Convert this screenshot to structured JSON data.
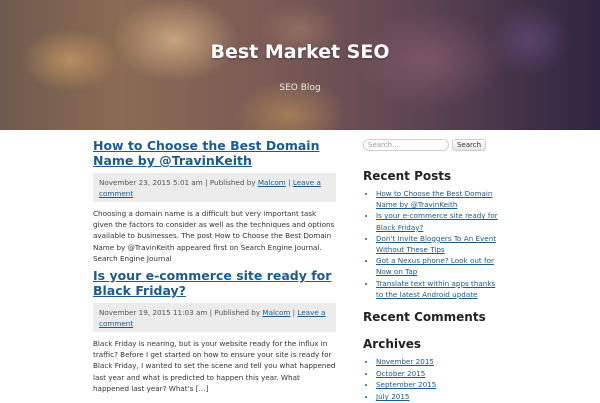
{
  "site": {
    "title": "Best Market SEO",
    "tagline": "SEO Blog"
  },
  "posts": [
    {
      "title": "How to Choose the Best Domain Name by @TravinKeith",
      "date": "November 23, 2015 5:01 am",
      "published_by_label": "| Published by",
      "author": "Malcom",
      "separator": "|",
      "comment_link": "Leave a comment",
      "excerpt": "Choosing a domain name is a difficult but very important task given the factors to consider as well as the techniques and options available to businesses. The post How to Choose the Best Domain Name by @TravinKeith appeared first on Search Engine Journal. Search Engine Journal"
    },
    {
      "title": "Is your e-commerce site ready for Black Friday?",
      "date": "November 19, 2015 11:03 am",
      "published_by_label": "| Published by",
      "author": "Malcom",
      "separator": "|",
      "comment_link": "Leave a comment",
      "excerpt": "Black Friday is nearing, but is your website ready for the influx in traffic? Before I get started on how to ensure your site is ready for Black Friday, I wanted to set the scene and tell you what happened last year and what is predicted to happen this year. What happened last year? What's […]"
    }
  ],
  "sidebar": {
    "search": {
      "placeholder": "Search...",
      "button_label": "Search"
    },
    "recent_posts": {
      "title": "Recent Posts",
      "items": [
        "How to Choose the Best Domain Name by @TravinKeith",
        "Is your e-commerce site ready for Black Friday?",
        "Don't Invite Bloggers To An Event Without These Tips",
        "Got a Nexus phone? Look out for Now on Tap",
        "Translate text within apps thanks to the latest Android update"
      ]
    },
    "recent_comments": {
      "title": "Recent Comments"
    },
    "archives": {
      "title": "Archives",
      "items": [
        "November 2015",
        "October 2015",
        "September 2015",
        "July 2015"
      ]
    }
  },
  "colors": {
    "link": "#1f5a8a",
    "meta_background": "#ececec",
    "header_dark": "#2e2440",
    "header_warm": "#8b6b52"
  }
}
